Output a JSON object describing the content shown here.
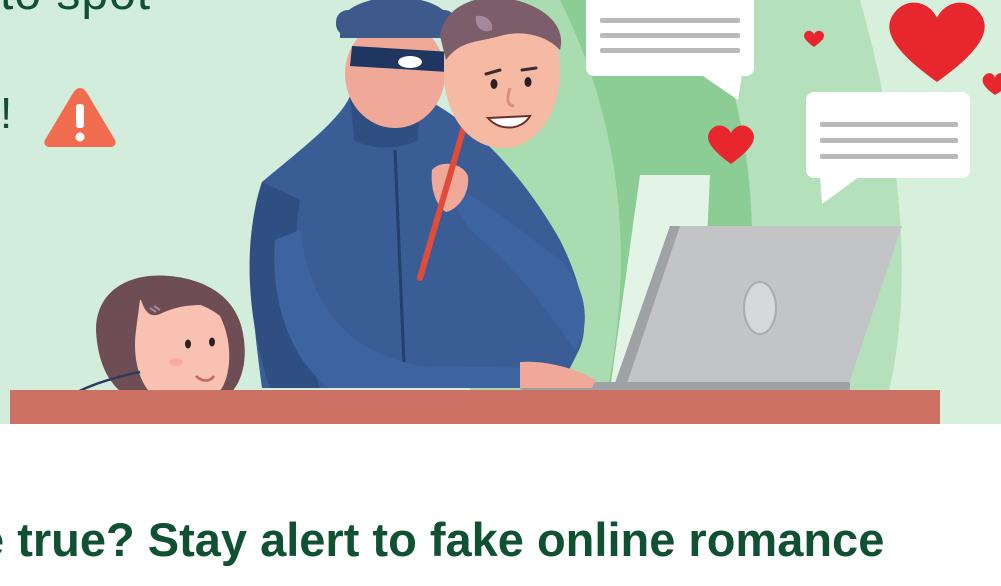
{
  "banner": {
    "headline_fragment": "to spot",
    "exclamation": "!",
    "warning_icon": "warning-triangle-icon"
  },
  "article": {
    "title": "e true? Stay alert to fake online romance"
  },
  "colors": {
    "background_mint": "#d3eddd",
    "curtain_green": "#8ccc95",
    "suit_blue": "#3a5d95",
    "desk_terracotta": "#cc7163",
    "heart_red": "#e8262e",
    "warning_orange": "#f26d4f",
    "title_green": "#0f5132",
    "laptop_gray": "#c2c4c6"
  }
}
